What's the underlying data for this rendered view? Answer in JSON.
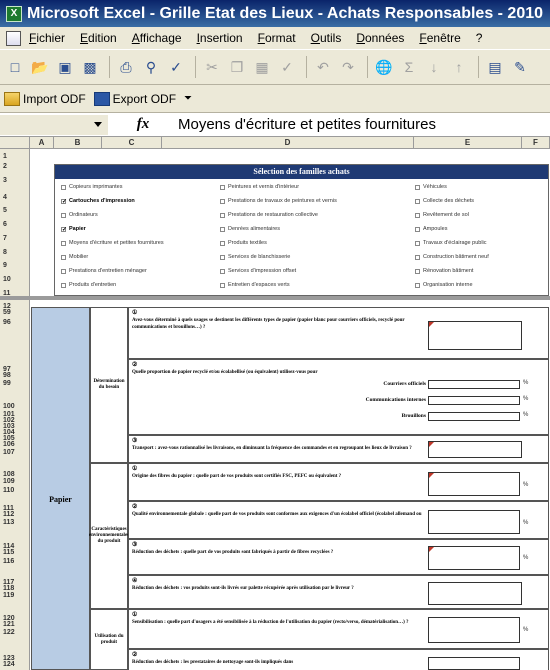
{
  "window": {
    "app_icon": "X",
    "title": "Microsoft Excel - Grille Etat des Lieux - Achats Responsables - 2010"
  },
  "menu": {
    "items": [
      "Fichier",
      "Edition",
      "Affichage",
      "Insertion",
      "Format",
      "Outils",
      "Données",
      "Fenêtre",
      "?"
    ]
  },
  "toolbar": {
    "icons": [
      "new-icon",
      "open-icon",
      "save-icon",
      "permission-icon",
      "print-icon",
      "print-preview-icon",
      "spelling-icon",
      "cut-icon",
      "copy-icon",
      "paste-icon",
      "format-painter-icon",
      "undo-icon",
      "redo-icon",
      "hyperlink-icon",
      "autosum-icon",
      "sort-ascending-icon",
      "sort-descending-icon",
      "chart-icon",
      "drawing-icon"
    ]
  },
  "odf": {
    "import_label": "Import ODF",
    "export_label": "Export ODF"
  },
  "formula": {
    "fx": "fx",
    "content": "Moyens d'écriture et petites fournitures"
  },
  "columns": [
    "A",
    "B",
    "C",
    "D",
    "E",
    "F"
  ],
  "rows": [
    "1",
    "2",
    "3",
    "4",
    "5",
    "6",
    "7",
    "8",
    "9",
    "10",
    "11",
    "12",
    "59",
    "96",
    "97",
    "98",
    "99",
    "100",
    "101",
    "102",
    "103",
    "104",
    "105",
    "106",
    "107",
    "108",
    "109",
    "110",
    "111",
    "112",
    "113",
    "114",
    "115",
    "116",
    "117",
    "118",
    "119",
    "120",
    "121",
    "122",
    "123",
    "124",
    "125"
  ],
  "selection": {
    "header": "Sélection des familles achats",
    "col1": [
      {
        "label": "Copieurs imprimantes",
        "checked": false
      },
      {
        "label": "Cartouches d'impression",
        "checked": true
      },
      {
        "label": "Ordinateurs",
        "checked": false
      },
      {
        "label": "Papier",
        "checked": true
      },
      {
        "label": "Moyens d'écriture et petites fournitures",
        "checked": false
      },
      {
        "label": "Mobilier",
        "checked": false
      },
      {
        "label": "Prestations d'entretien ménager",
        "checked": false
      },
      {
        "label": "Produits d'entretien",
        "checked": false
      }
    ],
    "col2": [
      {
        "label": "Peintures et vernis d'intérieur",
        "checked": false
      },
      {
        "label": "Prestations de travaux de peintures et vernis",
        "checked": false
      },
      {
        "label": "Prestations de restauration collective",
        "checked": false
      },
      {
        "label": "Denrées alimentaires",
        "checked": false
      },
      {
        "label": "Produits textiles",
        "checked": false
      },
      {
        "label": "Services de blanchisserie",
        "checked": false
      },
      {
        "label": "Services d'impression offset",
        "checked": false
      },
      {
        "label": "Entretien d'espaces verts",
        "checked": false
      }
    ],
    "col3": [
      {
        "label": "Véhicules",
        "checked": false
      },
      {
        "label": "Collecte des déchets",
        "checked": false
      },
      {
        "label": "Revêtement de sol",
        "checked": false
      },
      {
        "label": "Ampoules",
        "checked": false
      },
      {
        "label": "Travaux d'éclairage public",
        "checked": false
      },
      {
        "label": "Construction bâtiment neuf",
        "checked": false
      },
      {
        "label": "Rénovation bâtiment",
        "checked": false
      },
      {
        "label": "Organisation interne",
        "checked": false
      }
    ]
  },
  "papier": {
    "category": "Papier",
    "sub1": "Détermination du besoin",
    "sub2": "Caractéristiques environnementales du produit",
    "sub3": "Utilisation du produit",
    "q1": {
      "num": "①",
      "text": "Avez-vous déterminé à quels usages se destinent les différents types de papier (papier blanc pour courriers officiels, recyclé pour communications et brouillons…) ?"
    },
    "q2": {
      "num": "②",
      "text": "Quelle proportion de papier recyclé et/ou écolabellisé (ou équivalent) utilisez-vous pour",
      "lines": [
        "Courriers officiels",
        "Communications internes",
        "Brouillons"
      ]
    },
    "q3": {
      "num": "③",
      "text": "Transport : avez-vous rationnalisé les livraisons, en diminuant la fréquence des commandes et en regroupant les lieux de livraison ?"
    },
    "q4": {
      "num": "①",
      "text": "Origine des fibres du papier : quelle part de vos produits sont certifiés FSC, PEFC ou équivalent ?"
    },
    "q5": {
      "num": "②",
      "text": "Qualité environnementale globale : quelle part de vos produits sont conformes aux exigences d'un écolabel officiel (écolabel allemand ou"
    },
    "q6": {
      "num": "③",
      "text": "Réduction des déchets : quelle part de vos produits sont fabriqués à partir de fibres recyclées ?"
    },
    "q7": {
      "num": "④",
      "text": "Réduction des déchets : vos produits sont-ils livrés sur palette récupérée après utilisation par le livreur ?"
    },
    "q8": {
      "num": "①",
      "text": "Sensibilisation : quelle part d'usagers a été sensibilisée à la réduction de l'utilisation du papier (recto/verso, dématérialisation…) ?"
    },
    "q9": {
      "num": "②",
      "text": "Réduction des déchets : les prestataires de nettoyage sont-ils impliqués dans"
    },
    "pct_symbol": "%"
  }
}
